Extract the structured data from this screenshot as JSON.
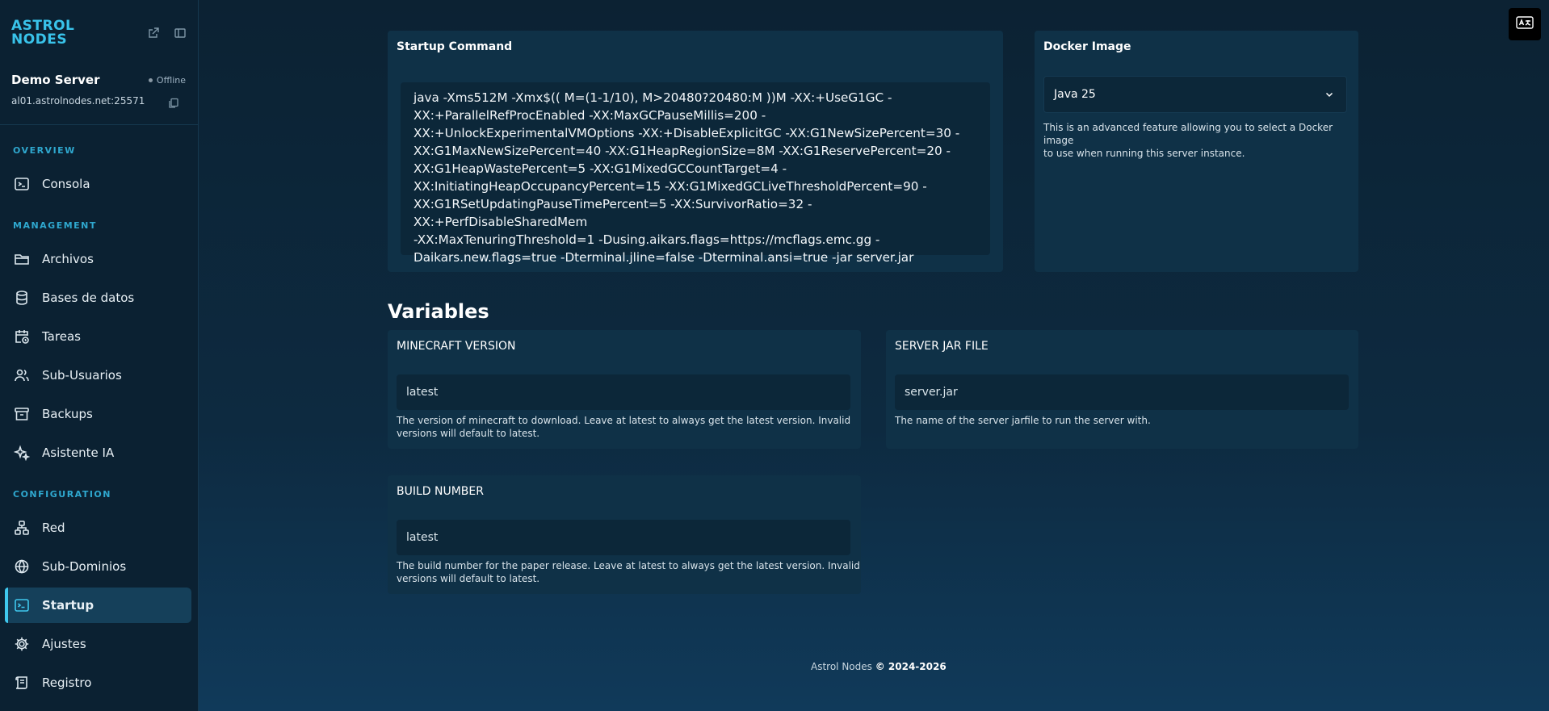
{
  "brand": {
    "line1": "ASTROL",
    "line2": "NODES",
    "color": "#39c3ea"
  },
  "server": {
    "name": "Demo Server",
    "status": "Offline",
    "address": "al01.astrolnodes.net:25571"
  },
  "sections": {
    "overview": "OVERVIEW",
    "management": "MANAGEMENT",
    "configuration": "CONFIGURATION"
  },
  "nav": {
    "consola": "Consola",
    "archivos": "Archivos",
    "bases": "Bases de datos",
    "tareas": "Tareas",
    "subusuarios": "Sub-Usuarios",
    "backups": "Backups",
    "asistente": "Asistente IA",
    "red": "Red",
    "subdominios": "Sub-Dominios",
    "startup": "Startup",
    "ajustes": "Ajustes",
    "registro": "Registro"
  },
  "startup": {
    "title": "Startup Command",
    "command": "java -Xms512M -Xmx$(( M=(1-1/10), M>20480?20480:M ))M -XX:+UseG1GC -\nXX:+ParallelRefProcEnabled -XX:MaxGCPauseMillis=200 -\nXX:+UnlockExperimentalVMOptions -XX:+DisableExplicitGC -XX:G1NewSizePercent=30 -\nXX:G1MaxNewSizePercent=40 -XX:G1HeapRegionSize=8M -XX:G1ReservePercent=20 -\nXX:G1HeapWastePercent=5 -XX:G1MixedGCCountTarget=4 -\nXX:InitiatingHeapOccupancyPercent=15 -XX:G1MixedGCLiveThresholdPercent=90 -\nXX:G1RSetUpdatingPauseTimePercent=5 -XX:SurvivorRatio=32 -XX:+PerfDisableSharedMem\n-XX:MaxTenuringThreshold=1 -Dusing.aikars.flags=https://mcflags.emc.gg -\nDaikars.new.flags=true -Dterminal.jline=false -Dterminal.ansi=true -jar server.jar"
  },
  "docker": {
    "title": "Docker Image",
    "selected": "Java 25",
    "help_line1": "This is an advanced feature allowing you to select a Docker image",
    "help_line2": "to use when running this server instance."
  },
  "variables": {
    "title": "Variables",
    "minecraft_version": {
      "label": "MINECRAFT VERSION",
      "value": "latest",
      "help_line1": "The version of minecraft to download. Leave at latest to always get the latest version. Invalid",
      "help_line2": "versions will default to latest."
    },
    "server_jar": {
      "label": "SERVER JAR FILE",
      "value": "server.jar",
      "help_line1": "The name of the server jarfile to run the server with."
    },
    "build_number": {
      "label": "BUILD NUMBER",
      "value": "latest",
      "help_line1": "The build number for the paper release. Leave at latest to always get the latest version. Invalid",
      "help_line2": "versions will default to latest."
    }
  },
  "footer": {
    "brand": "Astrol Nodes",
    "copyright": "© 2024-2026"
  },
  "colors": {
    "accent": "#3fc8ee",
    "card": "#0f3147",
    "input": "#0c2739"
  }
}
